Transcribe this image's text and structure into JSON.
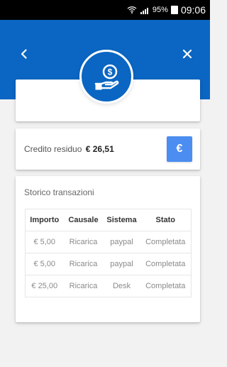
{
  "status_bar": {
    "battery_percent": "95%",
    "time": "09:06",
    "icons": [
      "wifi-icon",
      "signal-icon",
      "battery-icon"
    ]
  },
  "header": {
    "back_icon": "chevron-left-icon",
    "close_icon": "close-icon",
    "hero_icon": "hand-coin-dollar-icon"
  },
  "credit": {
    "label": "Credito residuo",
    "amount": "€ 26,51",
    "button_label": "€"
  },
  "transactions": {
    "title": "Storico transazioni",
    "columns": [
      "Importo",
      "Causale",
      "Sistema",
      "Stato"
    ],
    "rows": [
      [
        "€ 5,00",
        "Ricarica",
        "paypal",
        "Completata"
      ],
      [
        "€ 5,00",
        "Ricarica",
        "paypal",
        "Completata"
      ],
      [
        "€ 25,00",
        "Ricarica",
        "Desk",
        "Completata"
      ]
    ]
  },
  "colors": {
    "primary": "#0a66c2",
    "accent_button": "#4b8df0",
    "background": "#f2f2f2"
  }
}
